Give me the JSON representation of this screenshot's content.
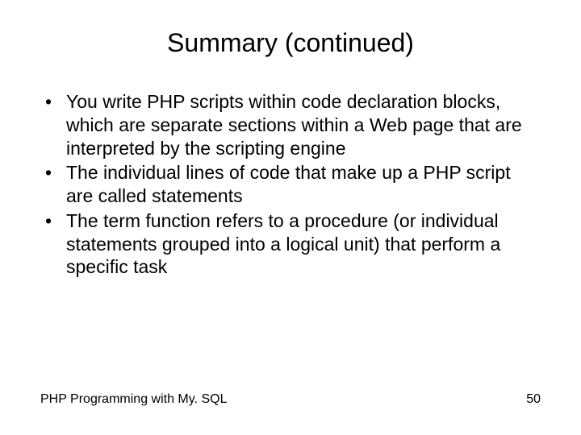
{
  "title": "Summary (continued)",
  "bullets": [
    "You write PHP scripts within code declaration blocks, which are separate sections within a Web page that are interpreted by the scripting engine",
    "The individual lines of code that make up a PHP script are called statements",
    "The term function refers to a procedure (or individual statements grouped into a logical unit) that perform a specific task"
  ],
  "footer": {
    "left": "PHP Programming with My. SQL",
    "right": "50"
  }
}
